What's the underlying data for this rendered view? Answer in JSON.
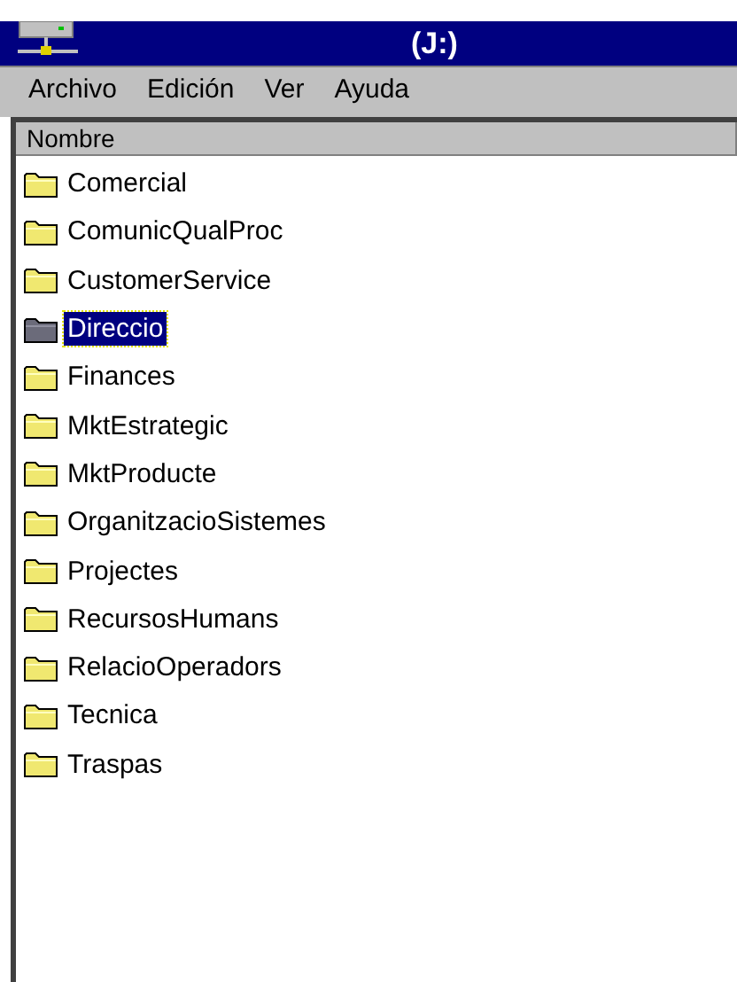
{
  "window": {
    "title": "(J:)"
  },
  "menu": [
    "Archivo",
    "Edición",
    "Ver",
    "Ayuda"
  ],
  "list": {
    "column": "Nombre",
    "items": [
      {
        "name": "Comercial",
        "selected": false
      },
      {
        "name": "ComunicQualProc",
        "selected": false
      },
      {
        "name": "CustomerService",
        "selected": false
      },
      {
        "name": "Direccio",
        "selected": true
      },
      {
        "name": "Finances",
        "selected": false
      },
      {
        "name": "MktEstrategic",
        "selected": false
      },
      {
        "name": "MktProducte",
        "selected": false
      },
      {
        "name": "OrganitzacioSistemes",
        "selected": false
      },
      {
        "name": "Projectes",
        "selected": false
      },
      {
        "name": "RecursosHumans",
        "selected": false
      },
      {
        "name": "RelacioOperadors",
        "selected": false
      },
      {
        "name": "Tecnica",
        "selected": false
      },
      {
        "name": "Traspas",
        "selected": false
      }
    ]
  }
}
